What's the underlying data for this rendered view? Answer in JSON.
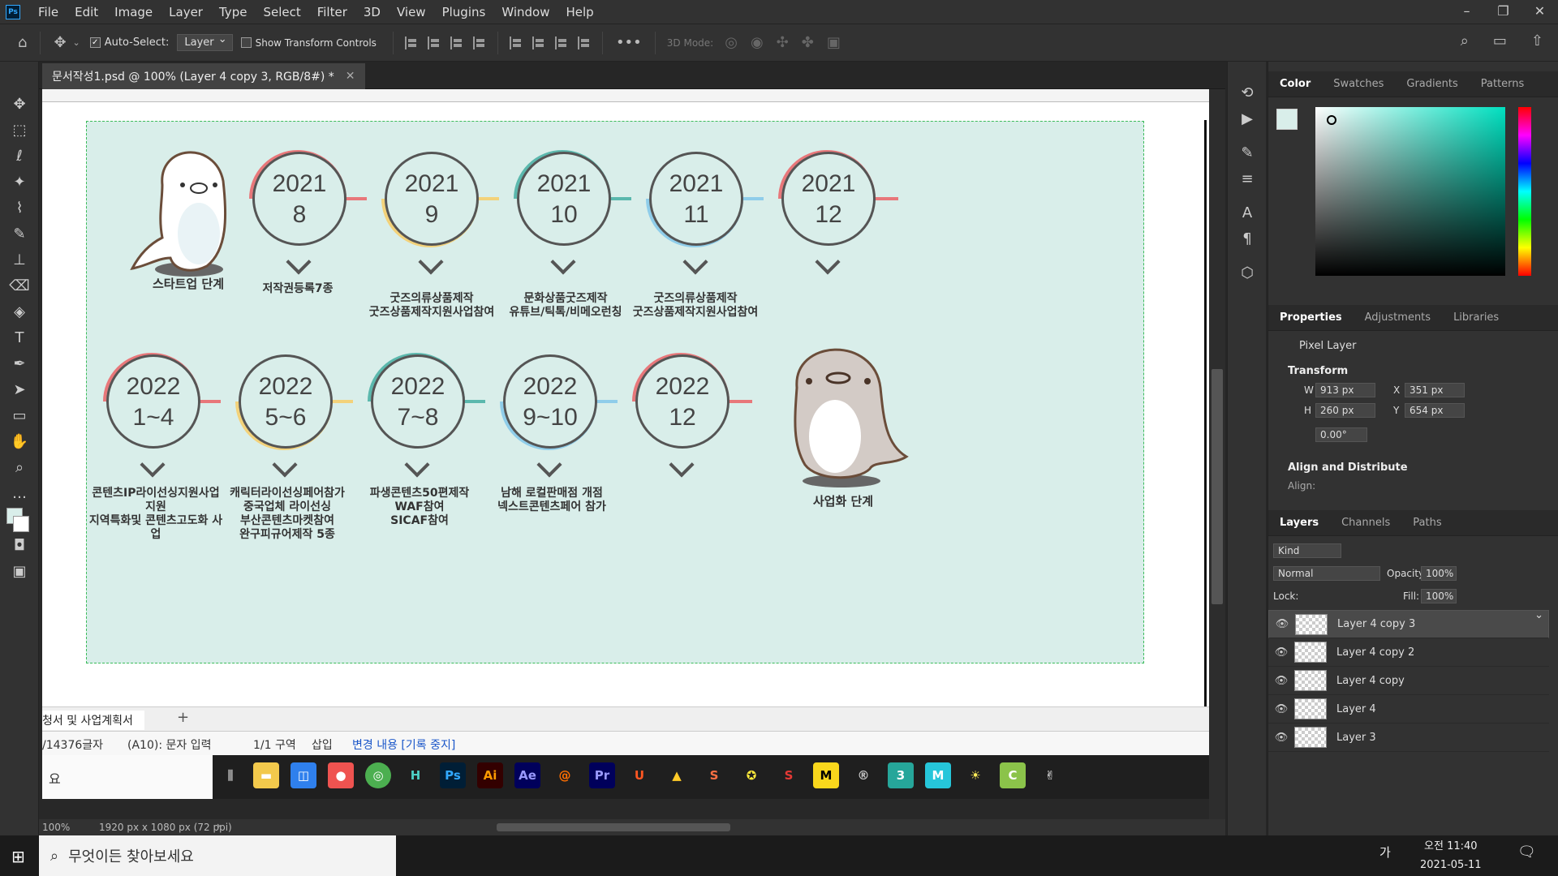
{
  "menubar": {
    "logo": "Ps",
    "items": [
      "File",
      "Edit",
      "Image",
      "Layer",
      "Type",
      "Select",
      "Filter",
      "3D",
      "View",
      "Plugins",
      "Window",
      "Help"
    ]
  },
  "options": {
    "auto_select_label": "Auto-Select:",
    "auto_select_value": "Layer",
    "show_transform": "Show Transform Controls",
    "mode_3d": "3D Mode:"
  },
  "doc_tab": {
    "title": "문서작성1.psd @ 100% (Layer 4 copy 3, RGB/8#) *"
  },
  "artwork": {
    "row1": [
      {
        "year": "2021",
        "month": "8",
        "caption": "저작권등록7종"
      },
      {
        "year": "2021",
        "month": "9",
        "caption": "굿즈의류상품제작\n굿즈상품제작지원사업참여"
      },
      {
        "year": "2021",
        "month": "10",
        "caption": "문화상품굿즈제작\n유튜브/틱톡/비메오런칭"
      },
      {
        "year": "2021",
        "month": "11",
        "caption": "굿즈의류상품제작\n굿즈상품제작지원사업참여"
      },
      {
        "year": "2021",
        "month": "12",
        "caption": ""
      }
    ],
    "row2": [
      {
        "year": "2022",
        "month": "1~4",
        "caption": "콘텐츠IP라이선싱지원사업 지원\n지역특화및 콘텐츠고도화 사업"
      },
      {
        "year": "2022",
        "month": "5~6",
        "caption": "캐릭터라이선싱페어참가\n중국업체 라이선싱\n부산콘텐츠마켓참여\n완구피규어제작 5종"
      },
      {
        "year": "2022",
        "month": "7~8",
        "caption": "파생콘텐츠50편제작\nWAF참여\nSICAF참여"
      },
      {
        "year": "2022",
        "month": "9~10",
        "caption": "남해 로컬판매점 개점\n넥스트콘텐츠페어 참가"
      },
      {
        "year": "2022",
        "month": "12",
        "caption": ""
      }
    ],
    "start_label": "스타트업 단계",
    "end_label": "사업화 단계",
    "colors": {
      "red": "#e8777a",
      "yellow": "#f3d27a",
      "teal": "#5bb8ad",
      "blue": "#8fcdea"
    }
  },
  "hwp": {
    "sheet_tab": "청서 및 사업계획서",
    "add": "+",
    "status": [
      "/14376글자",
      "(A10): 문자 입력",
      "1/1 구역",
      "삽입",
      "변경 내용 [기록 중지]"
    ],
    "search_fragment": "요"
  },
  "ps_status": {
    "zoom": "100%",
    "doc_size": "1920 px x 1080 px (72 ppi)"
  },
  "color_panel": {
    "tabs": [
      "Color",
      "Swatches",
      "Gradients",
      "Patterns"
    ]
  },
  "props_panel": {
    "tabs": [
      "Properties",
      "Adjustments",
      "Libraries"
    ],
    "kind": "Pixel Layer",
    "transform_title": "Transform",
    "w_label": "W",
    "w": "913 px",
    "x_label": "X",
    "x": "351 px",
    "h_label": "H",
    "h": "260 px",
    "y_label": "Y",
    "y": "654 px",
    "angle": "0.00°",
    "align_title": "Align and Distribute",
    "align_label": "Align:"
  },
  "layers_panel": {
    "tabs": [
      "Layers",
      "Channels",
      "Paths"
    ],
    "filter": "Kind",
    "blend": "Normal",
    "opacity_label": "Opacity:",
    "opacity": "100%",
    "lock_label": "Lock:",
    "fill_label": "Fill:",
    "fill": "100%",
    "layers": [
      "Layer 4 copy 3",
      "Layer 4 copy 2",
      "Layer 4 copy",
      "Layer 4",
      "Layer 3"
    ]
  },
  "taskbar": {
    "search": "무엇이든 찾아보세요",
    "time": "오전 11:40",
    "date": "2021-05-11",
    "ime": "가"
  }
}
